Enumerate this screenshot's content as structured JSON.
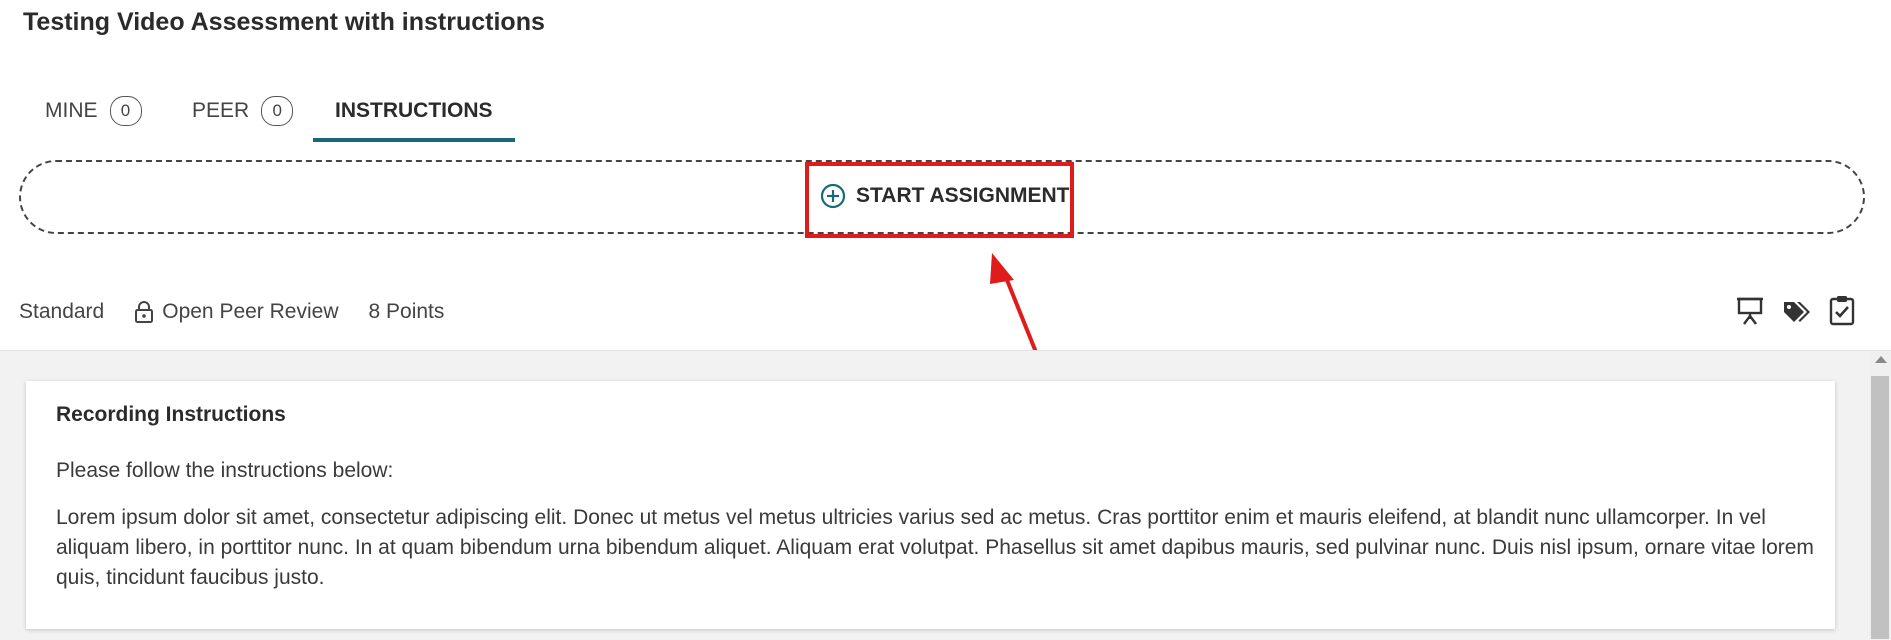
{
  "page": {
    "title": "Testing Video Assessment with instructions"
  },
  "tabs": [
    {
      "label": "MINE",
      "count": "0"
    },
    {
      "label": "PEER",
      "count": "0"
    },
    {
      "label": "INSTRUCTIONS"
    }
  ],
  "start": {
    "label": "START ASSIGNMENT"
  },
  "meta": {
    "type": "Standard",
    "review": "Open Peer Review",
    "points": "8 Points"
  },
  "toolbar_icons": [
    "presentation-icon",
    "tags-icon",
    "clipboard-check-icon"
  ],
  "instructions": {
    "heading": "Recording Instructions",
    "lead": "Please follow the instructions below:",
    "body": "Lorem ipsum dolor sit amet, consectetur adipiscing elit. Donec ut metus vel metus ultricies varius sed ac metus. Cras porttitor enim et mauris eleifend, at blandit nunc ullamcorper. In vel aliquam libero, in porttitor nunc. In at quam bibendum urna bibendum aliquet. Aliquam erat volutpat. Phasellus sit amet dapibus mauris, sed pulvinar nunc. Duis nisl ipsum, ornare vitae lorem quis, tincidunt faucibus justo."
  },
  "colors": {
    "accent": "#16697a",
    "annotation": "#e01b1b",
    "content_bg": "#f2f2f2"
  }
}
